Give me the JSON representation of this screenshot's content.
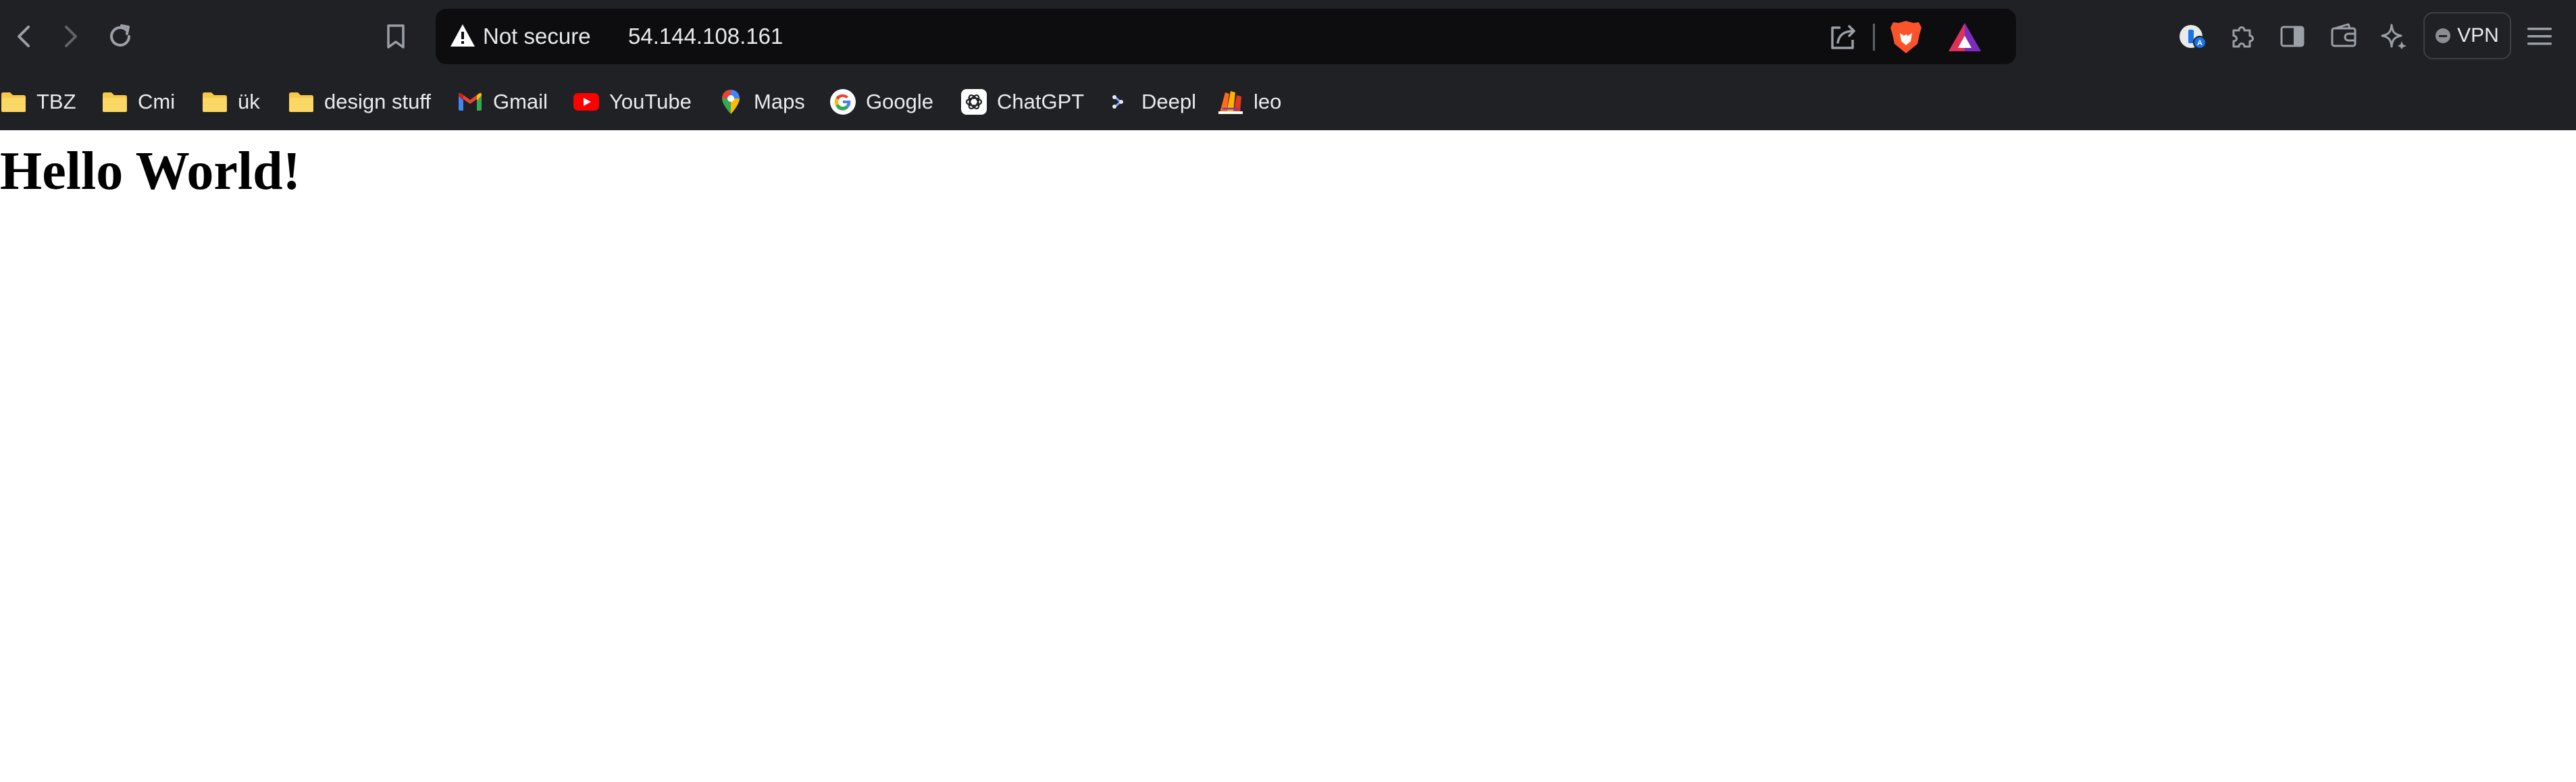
{
  "toolbar": {
    "back_icon": "arrow-left-icon",
    "forward_icon": "arrow-right-icon",
    "reload_icon": "reload-icon",
    "bookmark_page_icon": "bookmark-icon"
  },
  "address_bar": {
    "security_icon": "warning-triangle-icon",
    "security_label": "Not secure",
    "url": "54.144.108.161",
    "share_icon": "share-icon",
    "brave_shields_icon": "brave-lion-icon",
    "rewards_icon": "brave-rewards-triangle-icon"
  },
  "extensions": {
    "items": [
      {
        "icon": "password-manager-icon"
      },
      {
        "icon": "puzzle-extensions-icon"
      },
      {
        "icon": "sidebar-panel-icon"
      },
      {
        "icon": "wallet-icon"
      },
      {
        "icon": "leo-ai-sparkle-icon"
      }
    ],
    "vpn_label": "VPN",
    "menu_icon": "hamburger-menu-icon"
  },
  "bookmarks": [
    {
      "label": "TBZ",
      "icon": "folder-icon"
    },
    {
      "label": "Cmi",
      "icon": "folder-icon"
    },
    {
      "label": "ük",
      "icon": "folder-icon"
    },
    {
      "label": "design stuff",
      "icon": "folder-icon"
    },
    {
      "label": "Gmail",
      "icon": "gmail-icon"
    },
    {
      "label": "YouTube",
      "icon": "youtube-icon"
    },
    {
      "label": "Maps",
      "icon": "maps-pin-icon"
    },
    {
      "label": "Google",
      "icon": "google-g-icon"
    },
    {
      "label": "ChatGPT",
      "icon": "chatgpt-icon"
    },
    {
      "label": "Deepl",
      "icon": "deepl-icon"
    },
    {
      "label": "leo",
      "icon": "leo-icon"
    }
  ],
  "page": {
    "heading": "Hello World!"
  },
  "colors": {
    "chrome_background": "#202124",
    "address_bar_background": "#0d0d0f",
    "chrome_text": "#e8eaed",
    "folder_yellow": "#f7c948",
    "brave_orange": "#fb542b",
    "page_background": "#ffffff",
    "page_text": "#000000"
  }
}
